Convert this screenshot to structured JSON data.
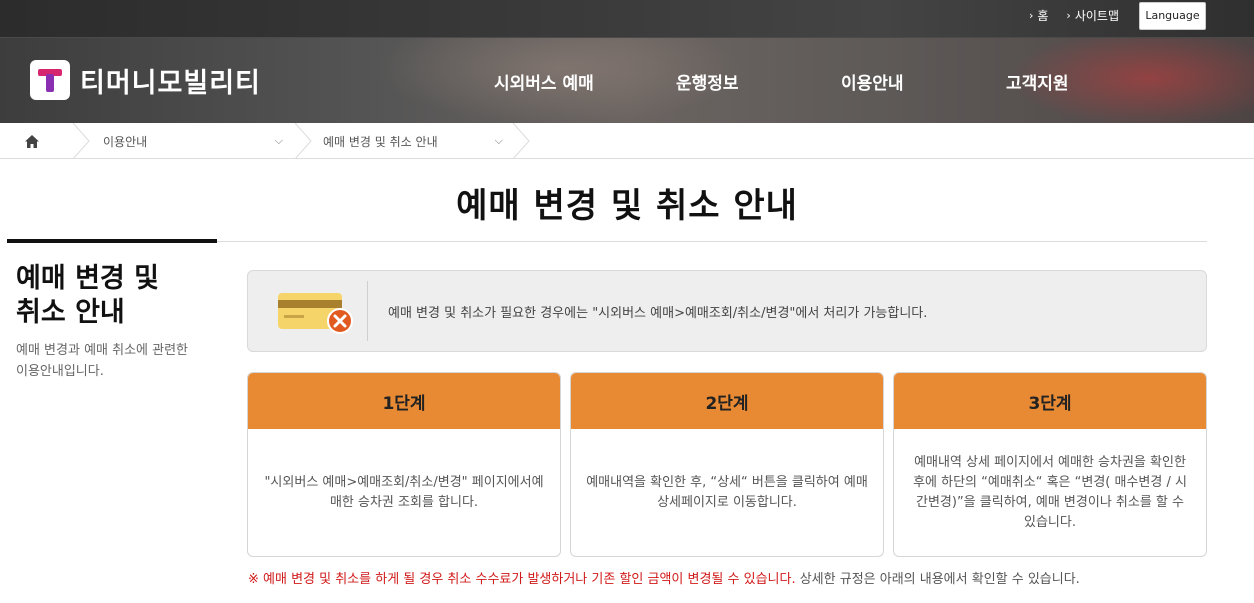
{
  "util": {
    "home": "홈",
    "sitemap": "사이트맵",
    "language": "Language"
  },
  "brand": {
    "name": "티머니모빌리티"
  },
  "gnb": [
    "시외버스 예매",
    "운행정보",
    "이용안내",
    "고객지원"
  ],
  "breadcrumb": {
    "level1": "이용안내",
    "level2": "예매 변경 및 취소 안내"
  },
  "page": {
    "title": "예매 변경 및 취소 안내"
  },
  "sidebar": {
    "title_line1": "예매 변경 및",
    "title_line2": "취소 안내",
    "desc_line1": "예매 변경과 예매 취소에 관련한",
    "desc_line2": "이용안내입니다."
  },
  "info": {
    "text": "예매 변경 및 취소가 필요한 경우에는 \"시외버스 예매>예매조회/취소/변경\"에서 처리가 가능합니다."
  },
  "steps": [
    {
      "title": "1단계",
      "body": "\"시외버스 예매>예매조회/취소/변경\" 페이지에서예매한 승차권 조회를 합니다."
    },
    {
      "title": "2단계",
      "body": "예매내역을 확인한 후, “상세“ 버튼을 클릭하여 예매 상세페이지로 이동합니다."
    },
    {
      "title": "3단계",
      "body": "예매내역 상세 페이지에서 예매한 승차권을 확인한 후에 하단의 “예매취소“ 혹은 “변경( 매수변경 / 시간변경)”을 클릭하여, 예매 변경이나 취소를 할 수 있습니다."
    }
  ],
  "notice": {
    "warning": "※ 예매 변경 및 취소를 하게 될 경우 취소 수수료가 발생하거나 기존 할인 금액이 변경될 수 있습니다.",
    "rest": " 상세한 규정은 아래의 내용에서 확인할 수 있습니다."
  },
  "colors": {
    "accent": "#e88a33",
    "warning": "#d11a1a",
    "brand_pink": "#d6266f",
    "brand_purple": "#8a2fb2"
  }
}
